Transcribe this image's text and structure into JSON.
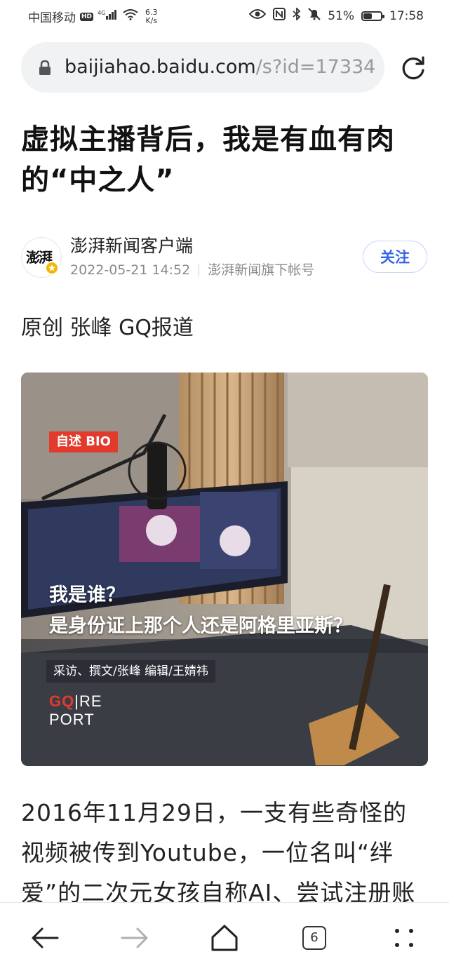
{
  "status_bar": {
    "carrier": "中国移动",
    "hd_badge": "HD",
    "network": "4G",
    "speed_value": "6.3",
    "speed_unit": "K/s",
    "battery": "51%",
    "battery_level": 0.51,
    "time": "17:58",
    "icons": [
      "eye-icon",
      "nfc-icon",
      "bluetooth-icon",
      "mute-bell-icon"
    ]
  },
  "address_bar": {
    "host": "baijiahao.baidu.com",
    "path": "/s?id=17334"
  },
  "article": {
    "title": "虚拟主播背后，我是有血有肉的“中之人”",
    "author": {
      "avatar_text": "澎湃",
      "name": "澎湃新闻客户端",
      "date": "2022-05-21 14:52",
      "account_note": "澎湃新闻旗下帐号",
      "follow_label": "关注"
    },
    "byline": "原创 张峰 GQ报道",
    "media": {
      "tag": "自述 BIO",
      "subtitle_line1": "我是谁？",
      "subtitle_line2": "是身份证上那个人还是阿格里亚斯？",
      "credit": "采访、撰文/张峰 编辑/王婧祎",
      "logo_mark": "GQ",
      "logo_text_1": "RE",
      "logo_text_2": "PORT"
    },
    "body": "2016年11月29日，一支有些奇怪的视频被传到Youtube，一位名叫“绊爱”的二次元女孩自称AI、尝试注册账"
  },
  "bottom_nav": {
    "tab_count": "6"
  }
}
